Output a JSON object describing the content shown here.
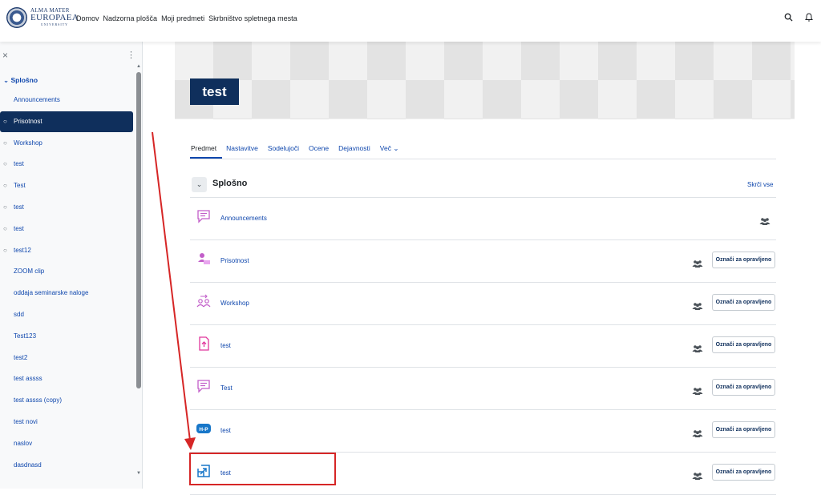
{
  "brand": {
    "line1": "ALMA MATER",
    "line2": "EUROPAEA",
    "line3": "UNIVERSITY"
  },
  "nav": {
    "links": [
      "Domov",
      "Nadzorna plošča",
      "Moji predmeti",
      "Skrbništvo spletnega mesta"
    ],
    "icons": [
      "search-icon",
      "bell-icon"
    ]
  },
  "drawer": {
    "section": "Splošno",
    "items": [
      {
        "label": "Announcements",
        "bullet": false,
        "active": false
      },
      {
        "label": "Prisotnost",
        "bullet": true,
        "active": true
      },
      {
        "label": "Workshop",
        "bullet": true,
        "active": false
      },
      {
        "label": "test",
        "bullet": true,
        "active": false
      },
      {
        "label": "Test",
        "bullet": true,
        "active": false
      },
      {
        "label": "test",
        "bullet": true,
        "active": false
      },
      {
        "label": "test",
        "bullet": true,
        "active": false
      },
      {
        "label": "test12",
        "bullet": true,
        "active": false
      },
      {
        "label": "ZOOM clip",
        "bullet": false,
        "active": false
      },
      {
        "label": "oddaja seminarske naloge",
        "bullet": false,
        "active": false
      },
      {
        "label": "sdd",
        "bullet": false,
        "active": false
      },
      {
        "label": "Test123",
        "bullet": false,
        "active": false
      },
      {
        "label": "test2",
        "bullet": false,
        "active": false
      },
      {
        "label": "test assss",
        "bullet": false,
        "active": false
      },
      {
        "label": "test assss (copy)",
        "bullet": false,
        "active": false
      },
      {
        "label": "test novi",
        "bullet": false,
        "active": false
      },
      {
        "label": "naslov",
        "bullet": false,
        "active": false
      },
      {
        "label": "dasdnasd",
        "bullet": false,
        "active": false
      }
    ]
  },
  "course": {
    "title": "test",
    "tabs": [
      "Predmet",
      "Nastavitve",
      "Sodelujoči",
      "Ocene",
      "Dejavnosti",
      "Več ⌄"
    ],
    "active_tab": "Predmet"
  },
  "section": {
    "title": "Splošno",
    "collapse_label": "Skrči vse",
    "toggle_glyph": "⌄"
  },
  "done_label": "Označi za opravljeno",
  "activities": [
    {
      "name": "Announcements",
      "icon": "forum-icon",
      "color": "#c25ec9",
      "done_button": false
    },
    {
      "name": "Prisotnost",
      "icon": "attendance-icon",
      "color": "#c25ec9",
      "done_button": true
    },
    {
      "name": "Workshop",
      "icon": "workshop-icon",
      "color": "#c25ec9",
      "done_button": true
    },
    {
      "name": "test",
      "icon": "assignment-icon",
      "color": "#e0369c",
      "done_button": true
    },
    {
      "name": "Test",
      "icon": "forum-icon",
      "color": "#c25ec9",
      "done_button": true
    },
    {
      "name": "test",
      "icon": "h5p-icon",
      "color": "#1877c9",
      "done_button": true
    },
    {
      "name": "test",
      "icon": "url-icon",
      "color": "#1877c9",
      "done_button": true
    }
  ],
  "colors": {
    "accent": "#0f47ad",
    "primary_dark": "#0f2f5c",
    "annotation": "#d62626"
  }
}
